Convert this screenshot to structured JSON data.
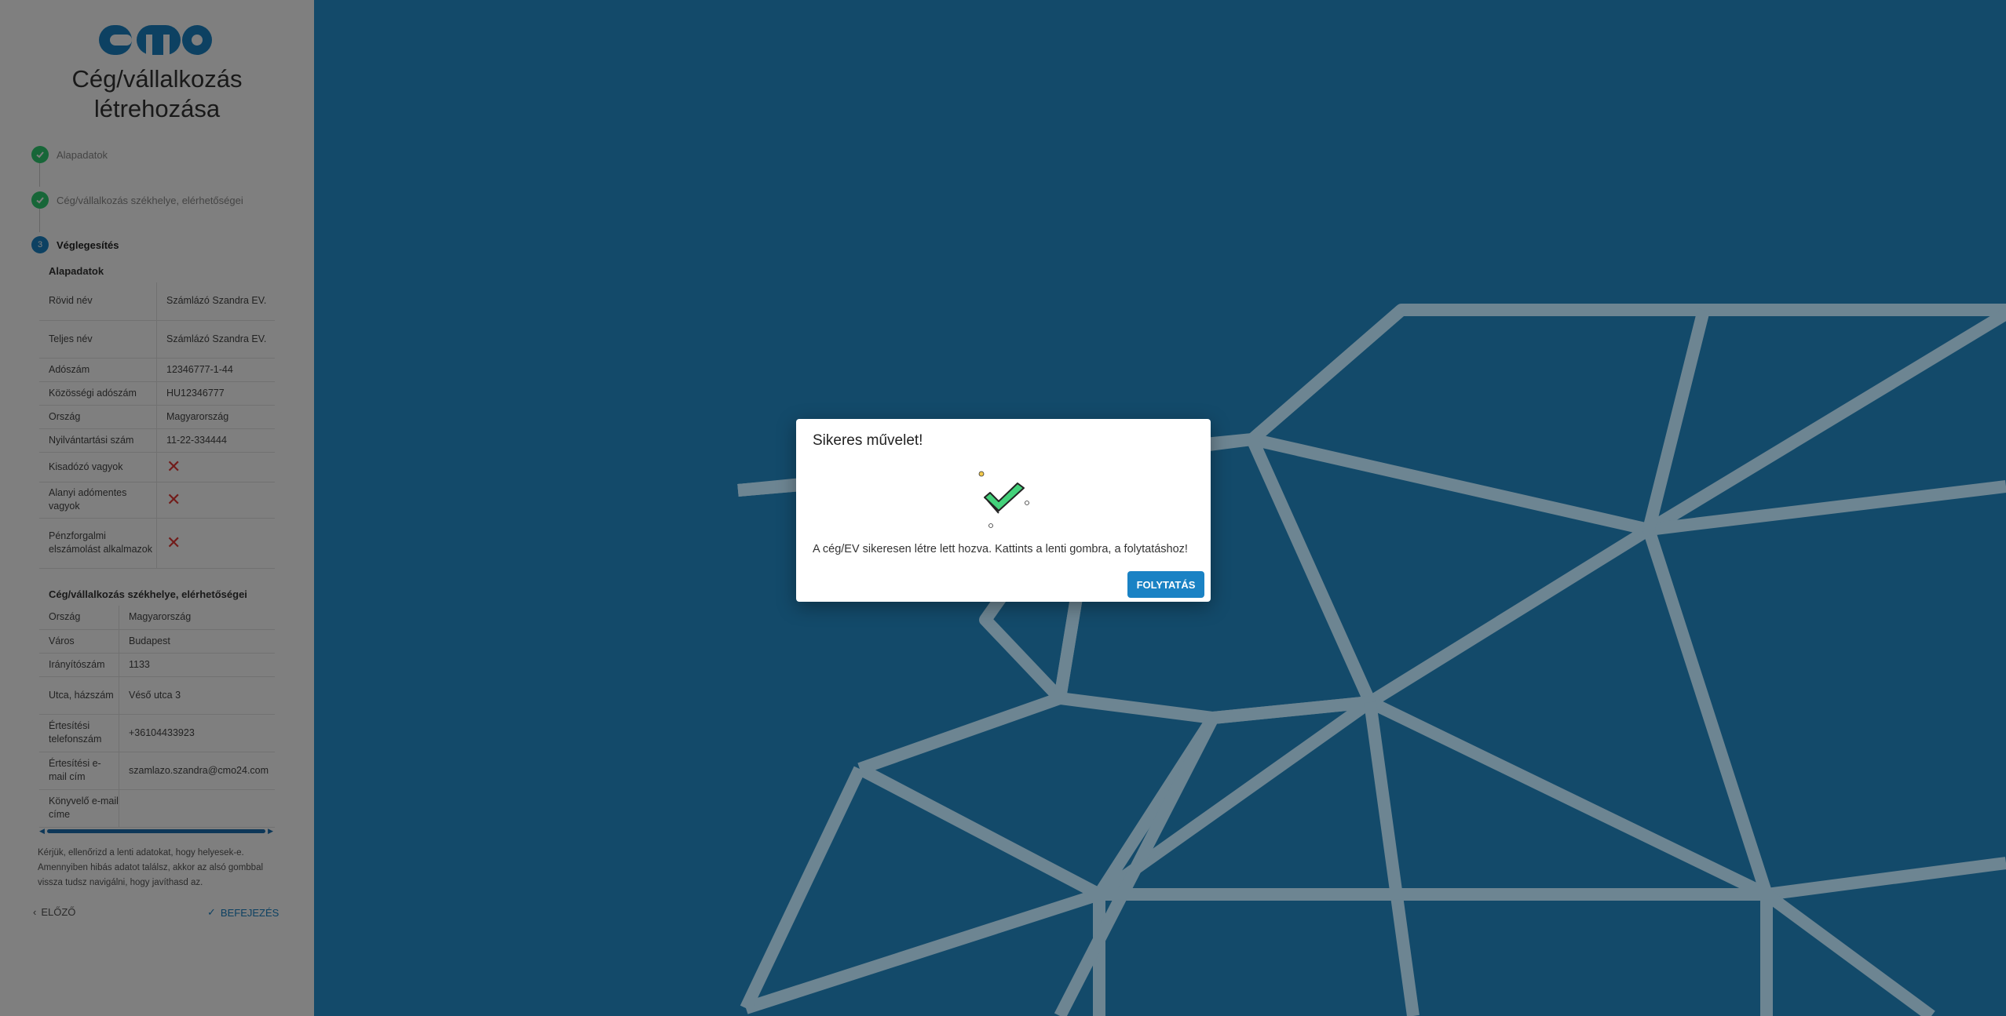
{
  "brand": {
    "logo_text": "cmo",
    "accent": "#1a82c4",
    "dark_bg": "#134a6a"
  },
  "sidebar": {
    "title_line1": "Cég/vállalkozás",
    "title_line2": "létrehozása",
    "steps": [
      {
        "number": "",
        "label": "Alapadatok",
        "state": "done"
      },
      {
        "number": "",
        "label": "Cég/vállalkozás székhelye, elérhetőségei",
        "state": "done"
      },
      {
        "number": "3",
        "label": "Véglegesítés",
        "state": "active"
      }
    ],
    "basic": {
      "title": "Alapadatok",
      "rows": [
        {
          "k": "Rövid név",
          "v": "Számlázó Szandra EV."
        },
        {
          "k": "Teljes név",
          "v": "Számlázó Szandra EV."
        },
        {
          "k": "Adószám",
          "v": "12346777-1-44"
        },
        {
          "k": "Közösségi adószám",
          "v": "HU12346777"
        },
        {
          "k": "Ország",
          "v": "Magyarország"
        },
        {
          "k": "Nyilvántartási szám",
          "v": "11-22-334444"
        },
        {
          "k": "Kisadózó vagyok",
          "v": "✕"
        },
        {
          "k": "Alanyi adómentes vagyok",
          "v": "✕"
        },
        {
          "k": "Pénzforgalmi elszámolást alkalmazok",
          "v": "✕"
        }
      ]
    },
    "address": {
      "title": "Cég/vállalkozás székhelye, elérhetőségei",
      "rows": [
        {
          "k": "Ország",
          "v": "Magyarország"
        },
        {
          "k": "Város",
          "v": "Budapest"
        },
        {
          "k": "Irányítószám",
          "v": "1133"
        },
        {
          "k": "Utca, házszám",
          "v": "Véső utca 3"
        },
        {
          "k": "Értesítési telefonszám",
          "v": "+36104433923"
        },
        {
          "k": "Értesítési e-mail cím",
          "v": "szamlazo.szandra@cmo24.com"
        },
        {
          "k": "Könyvelő e-mail címe",
          "v": ""
        }
      ]
    },
    "note": "Kérjük, ellenőrizd a lenti adatokat, hogy helyesek-e. Amennyiben hibás adatot találsz, akkor az alsó gombbal vissza tudsz navigálni, hogy javíthasd az.",
    "prev_label": "ELŐZŐ",
    "finish_label": "BEFEJEZÉS"
  },
  "modal": {
    "title": "Sikeres művelet!",
    "message": "A cég/EV sikeresen létre lett hozva. Kattints a lenti gombra, a folytatáshoz!",
    "button_label": "FOLYTATÁS",
    "icon": "check-success-icon"
  }
}
